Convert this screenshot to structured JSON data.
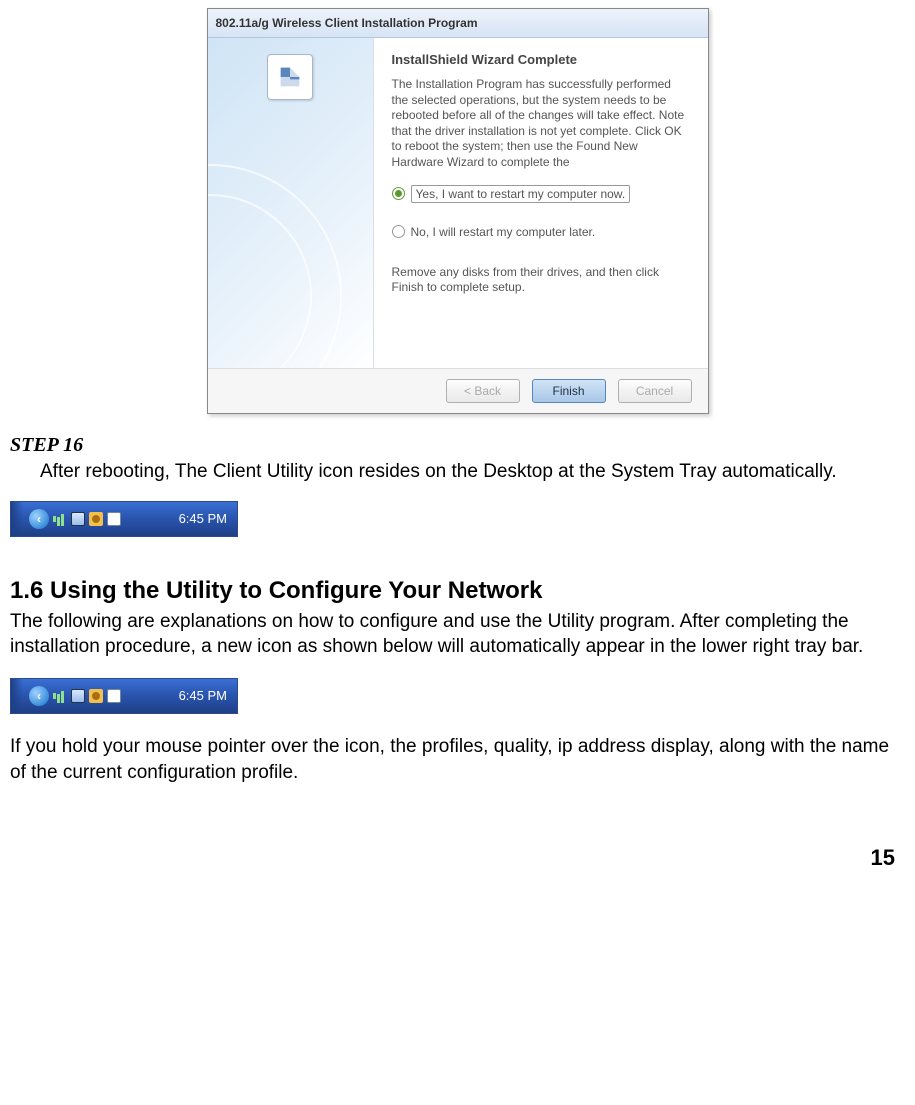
{
  "installer": {
    "title": "802.11a/g Wireless Client Installation Program",
    "heading": "InstallShield Wizard Complete",
    "body1": "The Installation Program has successfully performed the selected operations, but the system needs to be rebooted before all of the changes will take effect. Note that the driver installation is not yet complete. Click OK to reboot the system; then use the Found New Hardware Wizard to complete the",
    "option_yes": "Yes, I want to restart my computer now.",
    "option_no": "No, I will restart my computer later.",
    "body2": "Remove any disks from their drives, and then click Finish to complete setup.",
    "btn_back": "< Back",
    "btn_finish": "Finish",
    "btn_cancel": "Cancel"
  },
  "doc": {
    "step_label": "STEP 16",
    "step_text": "After rebooting, The Client Utility icon resides on the Desktop at the System Tray automatically.",
    "section_heading": "1.6 Using the Utility to Configure Your Network",
    "section_p1": "The following are explanations on how to configure and use the Utility program. After completing the installation procedure, a new icon as shown below will automatically appear in the lower right tray bar.",
    "section_p2": "If you hold your mouse pointer over the icon, the profiles, quality, ip address display, along with the name of the current configuration profile.",
    "page_number": "15"
  },
  "tray": {
    "time": "6:45 PM"
  }
}
